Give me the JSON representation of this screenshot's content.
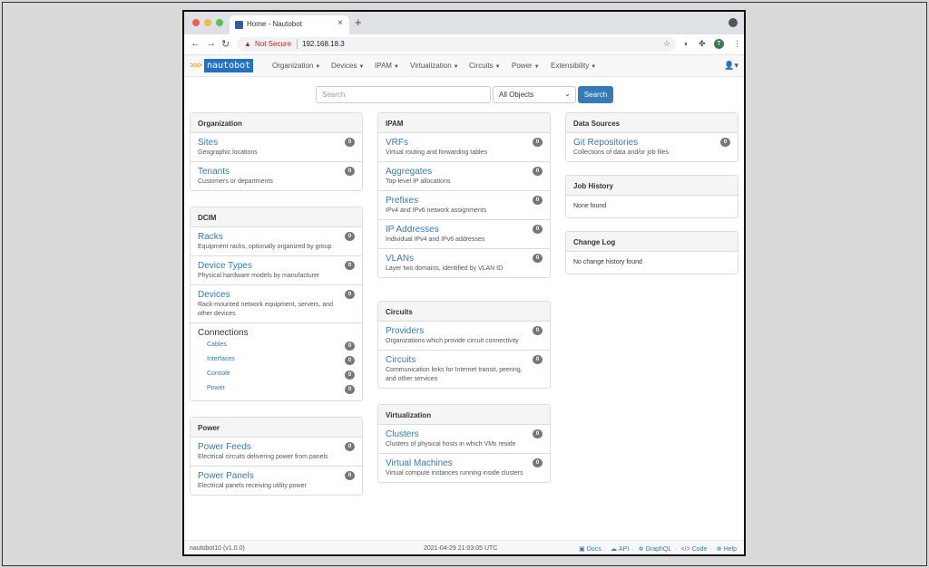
{
  "browser": {
    "tab_title": "Home - Nautobot",
    "tab_close": "×",
    "new_tab": "+",
    "security_label": "Not Secure",
    "url": "192.168.18.3",
    "profile_initial": "T"
  },
  "nav": {
    "logo_text": "nautobot",
    "logo_chevrons": ">>>",
    "menus": [
      "Organization",
      "Devices",
      "IPAM",
      "Virtualization",
      "Circuits",
      "Power",
      "Extensibility"
    ]
  },
  "search": {
    "placeholder": "Search",
    "scope": "All Objects",
    "button": "Search"
  },
  "panels": {
    "organization": {
      "title": "Organization",
      "items": [
        {
          "name": "Sites",
          "desc": "Geographic locations",
          "count": "0"
        },
        {
          "name": "Tenants",
          "desc": "Customers or departments",
          "count": "0"
        }
      ]
    },
    "dcim": {
      "title": "DCIM",
      "items": [
        {
          "name": "Racks",
          "desc": "Equipment racks, optionally organized by group",
          "count": "0"
        },
        {
          "name": "Device Types",
          "desc": "Physical hardware models by manufacturer",
          "count": "0"
        },
        {
          "name": "Devices",
          "desc": "Rack-mounted network equipment, servers, and other devices",
          "count": "0"
        }
      ],
      "connections": {
        "title": "Connections",
        "items": [
          {
            "name": "Cables",
            "count": "0"
          },
          {
            "name": "Interfaces",
            "count": "0"
          },
          {
            "name": "Console",
            "count": "0"
          },
          {
            "name": "Power",
            "count": "0"
          }
        ]
      }
    },
    "power": {
      "title": "Power",
      "items": [
        {
          "name": "Power Feeds",
          "desc": "Electrical circuits delivering power from panels",
          "count": "0"
        },
        {
          "name": "Power Panels",
          "desc": "Electrical panels receiving utility power",
          "count": "0"
        }
      ]
    },
    "ipam": {
      "title": "IPAM",
      "items": [
        {
          "name": "VRFs",
          "desc": "Virtual routing and forwarding tables",
          "count": "0"
        },
        {
          "name": "Aggregates",
          "desc": "Top-level IP allocations",
          "count": "0"
        },
        {
          "name": "Prefixes",
          "desc": "IPv4 and IPv6 network assignments",
          "count": "0"
        },
        {
          "name": "IP Addresses",
          "desc": "Individual IPv4 and IPv6 addresses",
          "count": "0"
        },
        {
          "name": "VLANs",
          "desc": "Layer two domains, identified by VLAN ID",
          "count": "0"
        }
      ]
    },
    "circuits": {
      "title": "Circuits",
      "items": [
        {
          "name": "Providers",
          "desc": "Organizations which provide circuit connectivity",
          "count": "0"
        },
        {
          "name": "Circuits",
          "desc": "Communication links for Internet transit, peering, and other services",
          "count": "0"
        }
      ]
    },
    "virtualization": {
      "title": "Virtualization",
      "items": [
        {
          "name": "Clusters",
          "desc": "Clusters of physical hosts in which VMs reside",
          "count": "0"
        },
        {
          "name": "Virtual Machines",
          "desc": "Virtual compute instances running inside clusters",
          "count": "0"
        }
      ]
    },
    "data_sources": {
      "title": "Data Sources",
      "items": [
        {
          "name": "Git Repositories",
          "desc": "Collections of data and/or job files",
          "count": "0"
        }
      ]
    },
    "job_history": {
      "title": "Job History",
      "empty": "None found"
    },
    "change_log": {
      "title": "Change Log",
      "empty": "No change history found"
    }
  },
  "footer": {
    "host": "nautobot10 (v1.0.0)",
    "timestamp": "2021-04-29 21:03:05 UTC",
    "links": [
      "Docs",
      "API",
      "GraphQL",
      "Code",
      "Help"
    ]
  },
  "colors": {
    "accent": "#337ab7",
    "badge": "#777777",
    "logo_bg": "#1e73c9"
  }
}
